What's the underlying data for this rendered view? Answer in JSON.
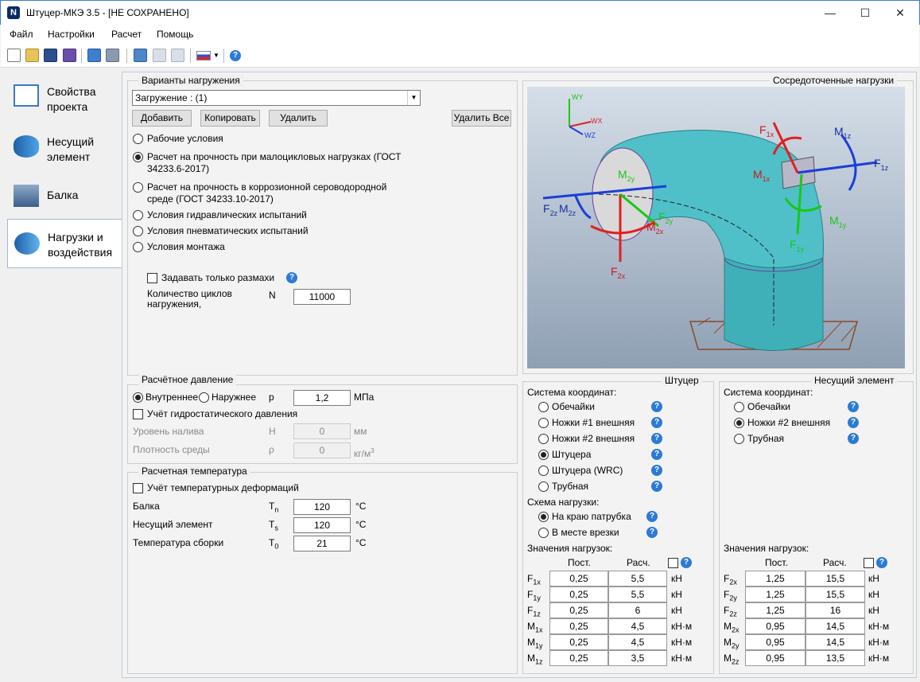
{
  "window": {
    "title": "Штуцер-МКЭ 3.5 - [НЕ СОХРАНЕНО]",
    "app_icon": "N",
    "minimize": "—",
    "maximize": "☐",
    "close": "✕"
  },
  "menu": [
    "Файл",
    "Настройки",
    "Расчет",
    "Помощь"
  ],
  "nav": [
    {
      "label": "Свойства проекта",
      "icon": "document-icon"
    },
    {
      "label": "Несущий элемент",
      "icon": "pipe-icon"
    },
    {
      "label": "Балка",
      "icon": "beam-icon"
    },
    {
      "label": "Нагрузки и воздействия",
      "icon": "loads-icon"
    }
  ],
  "loads": {
    "title": "Варианты нагружения",
    "selected": "Загружение : (1)",
    "add": "Добавить",
    "copy": "Копировать",
    "delete": "Удалить",
    "delete_all": "Удалить Все",
    "conditions": [
      "Рабочие условия",
      "Расчет на прочность при малоцикловых нагрузках (ГОСТ 34233.6-2017)",
      "Расчет на прочность в коррозионной сероводородной среде (ГОСТ 34233.10-2017)",
      "Условия гидравлических испытаний",
      "Условия пневматических испытаний",
      "Условия монтажа"
    ],
    "ranges_only": "Задавать только размахи",
    "cycles_label": "Количество циклов нагружения,",
    "cycles_sym": "N",
    "cycles_value": "11000"
  },
  "pressure": {
    "title": "Расчётное давление",
    "inner": "Внутреннее",
    "outer": "Наружнее",
    "sym": "p",
    "value": "1,2",
    "unit": "МПа",
    "hydro": "Учёт гидростатического давления",
    "level_label": "Уровень налива",
    "level_sym": "H",
    "level_value": "0",
    "level_unit": "мм",
    "dens_label": "Плотность среды",
    "dens_sym": "ρ",
    "dens_value": "0",
    "dens_unit": "кг/м",
    "dens_unit_sup": "3"
  },
  "temp": {
    "title": "Расчетная температура",
    "thermal": "Учёт температурных деформаций",
    "rows": [
      {
        "label": "Балка",
        "sym": "T",
        "sub": "n",
        "value": "120",
        "unit": "°C"
      },
      {
        "label": "Несущий элемент",
        "sym": "T",
        "sub": "s",
        "value": "120",
        "unit": "°C"
      },
      {
        "label": "Температура сборки",
        "sym": "T",
        "sub": "0",
        "value": "21",
        "unit": "°C"
      }
    ]
  },
  "diagram": {
    "title": "Сосредоточенные нагрузки",
    "labels": [
      {
        "t": "F",
        "s": "1x"
      },
      {
        "t": "M",
        "s": "1z"
      },
      {
        "t": "F",
        "s": "1z"
      },
      {
        "t": "M",
        "s": "1x"
      },
      {
        "t": "M",
        "s": "2y"
      },
      {
        "t": "F",
        "s": "2y"
      },
      {
        "t": "F",
        "s": "2z"
      },
      {
        "t": "M",
        "s": "2z"
      },
      {
        "t": "M",
        "s": "2x"
      },
      {
        "t": "F",
        "s": "2x"
      },
      {
        "t": "M",
        "s": "1y"
      },
      {
        "t": "F",
        "s": "1y"
      }
    ],
    "axes": [
      "WY",
      "WX",
      "WZ"
    ]
  },
  "nozzle": {
    "title": "Штуцер",
    "coord_title": "Система координат:",
    "coords": [
      "Обечайки",
      "Ножки #1 внешняя",
      "Ножки #2 внешняя",
      "Штуцера",
      "Штуцера (WRC)",
      "Трубная"
    ],
    "scheme_title": "Схема нагрузки:",
    "schemes": [
      "На краю патрубка",
      "В месте врезки"
    ],
    "values_title": "Значения нагрузок:",
    "col_const": "Пост.",
    "col_calc": "Расч.",
    "rows": [
      {
        "sym": "F",
        "sub": "1x",
        "const": "0,25",
        "calc": "5,5",
        "unit": "кН"
      },
      {
        "sym": "F",
        "sub": "1y",
        "const": "0,25",
        "calc": "5,5",
        "unit": "кН"
      },
      {
        "sym": "F",
        "sub": "1z",
        "const": "0,25",
        "calc": "6",
        "unit": "кН"
      },
      {
        "sym": "M",
        "sub": "1x",
        "const": "0,25",
        "calc": "4,5",
        "unit": "кН·м"
      },
      {
        "sym": "M",
        "sub": "1y",
        "const": "0,25",
        "calc": "4,5",
        "unit": "кН·м"
      },
      {
        "sym": "M",
        "sub": "1z",
        "const": "0,25",
        "calc": "3,5",
        "unit": "кН·м"
      }
    ]
  },
  "shell": {
    "title": "Несущий элемент",
    "coord_title": "Система координат:",
    "coords": [
      "Обечайки",
      "Ножки #2 внешняя",
      "Трубная"
    ],
    "values_title": "Значения нагрузок:",
    "col_const": "Пост.",
    "col_calc": "Расч.",
    "rows": [
      {
        "sym": "F",
        "sub": "2x",
        "const": "1,25",
        "calc": "15,5",
        "unit": "кН"
      },
      {
        "sym": "F",
        "sub": "2y",
        "const": "1,25",
        "calc": "15,5",
        "unit": "кН"
      },
      {
        "sym": "F",
        "sub": "2z",
        "const": "1,25",
        "calc": "16",
        "unit": "кН"
      },
      {
        "sym": "M",
        "sub": "2x",
        "const": "0,95",
        "calc": "14,5",
        "unit": "кН·м"
      },
      {
        "sym": "M",
        "sub": "2y",
        "const": "0,95",
        "calc": "14,5",
        "unit": "кН·м"
      },
      {
        "sym": "M",
        "sub": "2z",
        "const": "0,95",
        "calc": "13,5",
        "unit": "кН·м"
      }
    ]
  },
  "help_glyph": "?"
}
